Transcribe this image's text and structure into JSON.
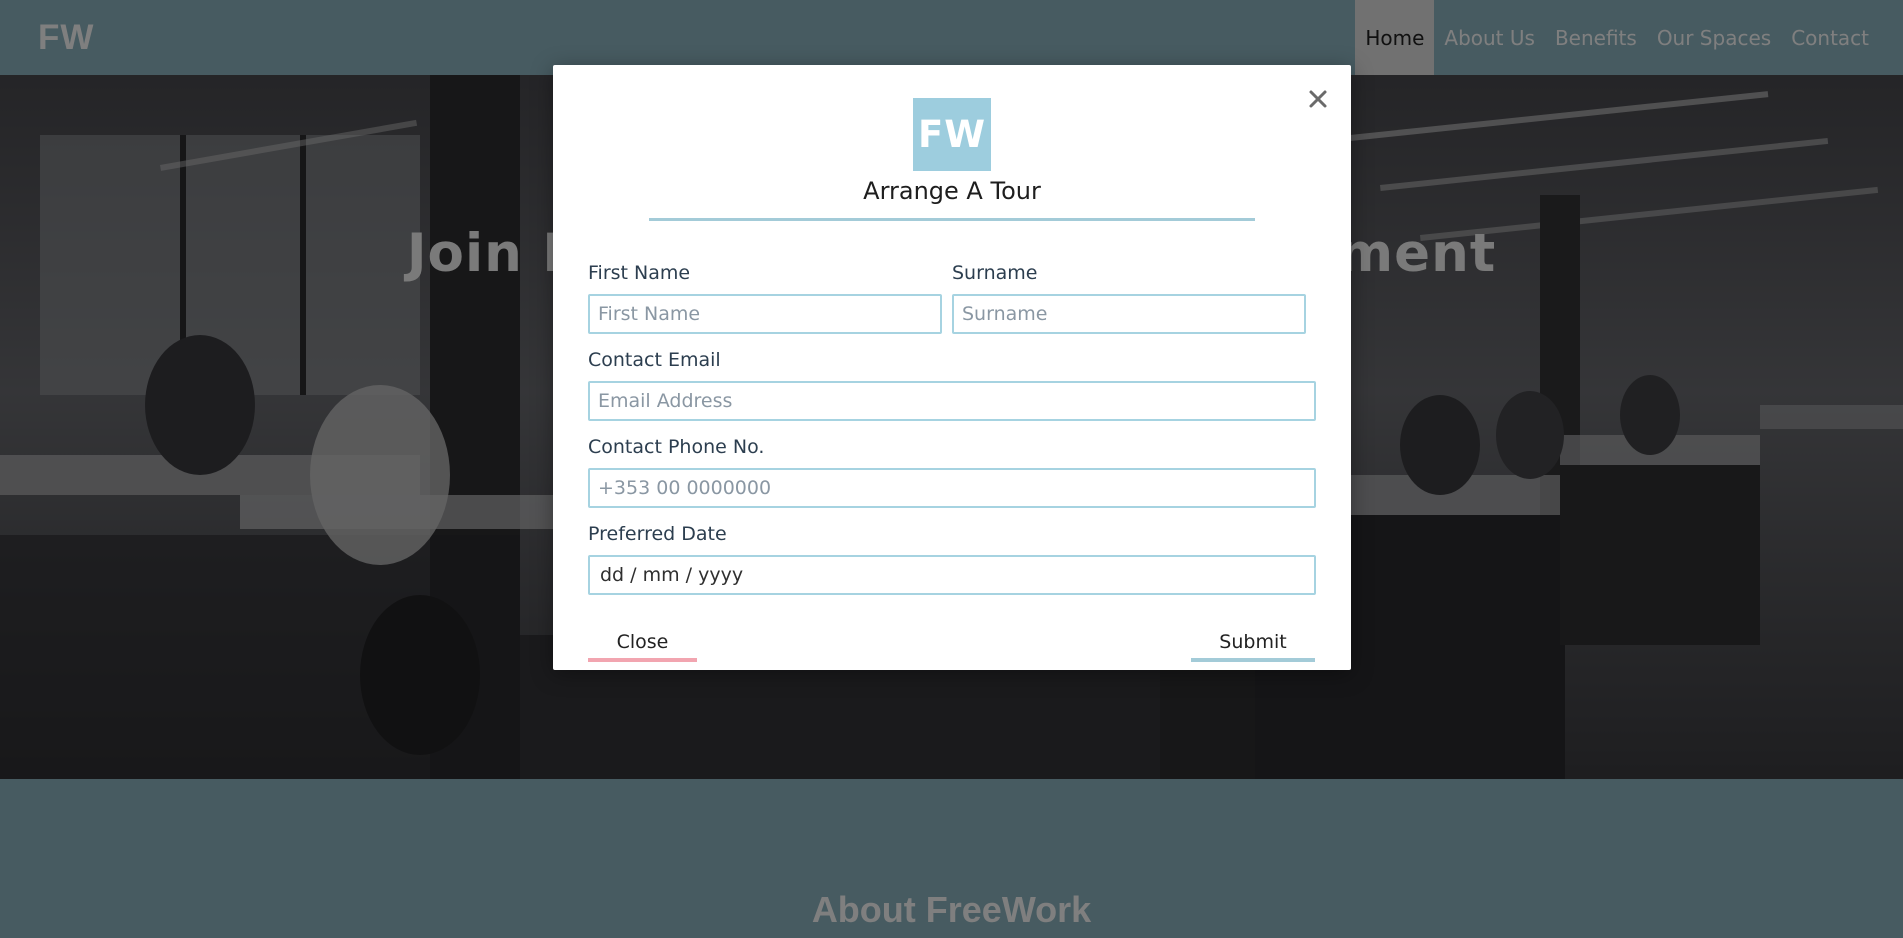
{
  "nav": {
    "brand": "FW",
    "links": [
      "Home",
      "About Us",
      "Benefits",
      "Our Spaces",
      "Contact"
    ],
    "active_link": "Home"
  },
  "hero": {
    "title": "Join Ireland's Coworking Movement"
  },
  "about": {
    "title": "About FreeWork"
  },
  "modal": {
    "logo_text": "FW",
    "title": "Arrange A Tour",
    "close_icon": "close-icon",
    "fields": {
      "first_name": {
        "label": "First Name",
        "placeholder": "First Name",
        "value": ""
      },
      "surname": {
        "label": "Surname",
        "placeholder": "Surname",
        "value": ""
      },
      "email": {
        "label": "Contact Email",
        "placeholder": "Email Address",
        "value": ""
      },
      "phone": {
        "label": "Contact Phone No.",
        "placeholder": "+353 00 0000000",
        "value": ""
      },
      "date": {
        "label": "Preferred Date",
        "display": "dd / mm / yyyy"
      }
    },
    "buttons": {
      "close": "Close",
      "submit": "Submit"
    }
  },
  "colors": {
    "brand_teal": "#9dcdde",
    "input_border": "#a6d3e1",
    "close_accent": "#f2a5b0",
    "submit_accent": "#a3cbd8",
    "nav_background": "#8fb6c3"
  }
}
